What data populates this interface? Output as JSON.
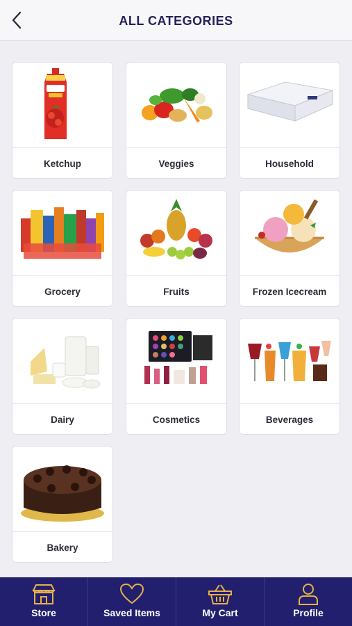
{
  "header": {
    "title": "ALL CATEGORIES",
    "back_icon": "back-chevron-icon"
  },
  "categories": [
    {
      "label": "Ketchup",
      "image": "ketchup-pouch-image"
    },
    {
      "label": "Veggies",
      "image": "vegetables-image"
    },
    {
      "label": "Household",
      "image": "mattress-image"
    },
    {
      "label": "Grocery",
      "image": "grocery-products-image"
    },
    {
      "label": "Fruits",
      "image": "fruits-image"
    },
    {
      "label": "Frozen Icecream",
      "image": "icecream-bowl-image"
    },
    {
      "label": "Dairy",
      "image": "dairy-products-image"
    },
    {
      "label": "Cosmetics",
      "image": "cosmetics-image"
    },
    {
      "label": "Beverages",
      "image": "beverage-glasses-image"
    },
    {
      "label": "Bakery",
      "image": "chocolate-cake-image"
    }
  ],
  "tabbar": {
    "items": [
      {
        "label": "Store",
        "icon": "store-icon"
      },
      {
        "label": "Saved Items",
        "icon": "heart-icon"
      },
      {
        "label": "My Cart",
        "icon": "basket-icon"
      },
      {
        "label": "Profile",
        "icon": "person-icon"
      }
    ]
  },
  "colors": {
    "header_text": "#23245a",
    "tabbar_bg": "#22206e",
    "tab_icon": "#e8b04a",
    "page_bg": "#eeeef3"
  }
}
